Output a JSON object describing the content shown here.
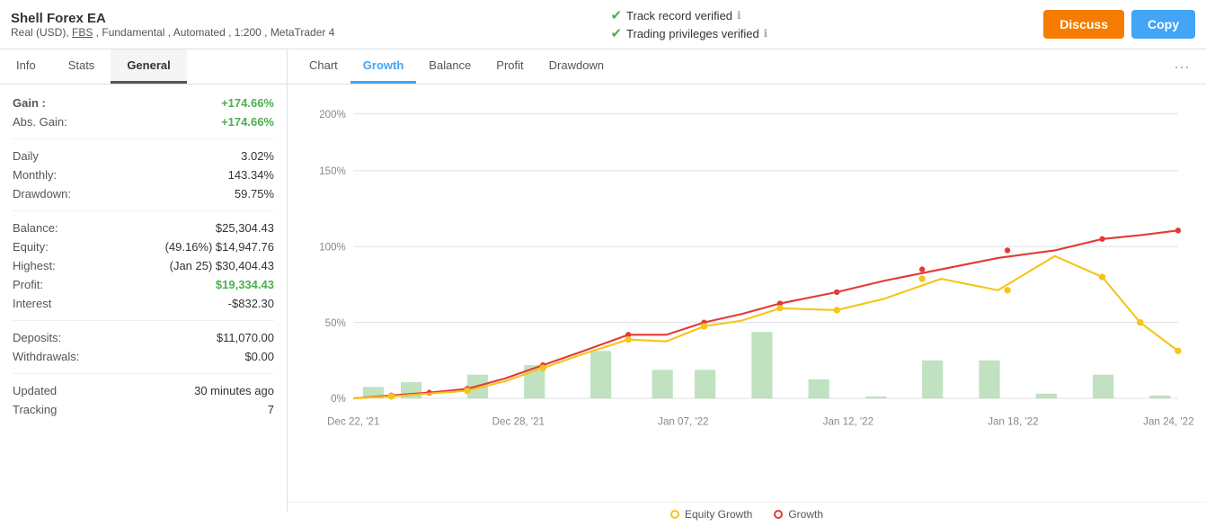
{
  "topbar": {
    "title": "Shell Forex EA",
    "subtitle": "Real (USD),  FBS , Fundamental , Automated , 1:200 , MetaTrader 4",
    "verified1": "Track record verified",
    "verified2": "Trading privileges verified",
    "btn_discuss": "Discuss",
    "btn_copy": "Copy"
  },
  "left_tabs": [
    {
      "label": "Info",
      "active": false
    },
    {
      "label": "Stats",
      "active": false
    },
    {
      "label": "General",
      "active": true
    }
  ],
  "stats": {
    "gain_label": "Gain :",
    "gain_value": "+174.66%",
    "abs_gain_label": "Abs. Gain:",
    "abs_gain_value": "+174.66%",
    "daily_label": "Daily",
    "daily_value": "3.02%",
    "monthly_label": "Monthly:",
    "monthly_value": "143.34%",
    "drawdown_label": "Drawdown:",
    "drawdown_value": "59.75%",
    "balance_label": "Balance:",
    "balance_value": "$25,304.43",
    "equity_label": "Equity:",
    "equity_value": "(49.16%) $14,947.76",
    "highest_label": "Highest:",
    "highest_value": "(Jan 25) $30,404.43",
    "profit_label": "Profit:",
    "profit_value": "$19,334.43",
    "interest_label": "Interest",
    "interest_value": "-$832.30",
    "deposits_label": "Deposits:",
    "deposits_value": "$11,070.00",
    "withdrawals_label": "Withdrawals:",
    "withdrawals_value": "$0.00",
    "updated_label": "Updated",
    "updated_value": "30 minutes ago",
    "tracking_label": "Tracking",
    "tracking_value": "7"
  },
  "chart_tabs": [
    {
      "label": "Chart",
      "active": false
    },
    {
      "label": "Growth",
      "active": true
    },
    {
      "label": "Balance",
      "active": false
    },
    {
      "label": "Profit",
      "active": false
    },
    {
      "label": "Drawdown",
      "active": false
    }
  ],
  "legend": {
    "equity_label": "Equity Growth",
    "growth_label": "Growth",
    "equity_color": "#f5c518",
    "growth_color": "#e53935"
  },
  "x_labels": [
    "Dec 22, '21",
    "Dec 28, '21",
    "Jan 07, '22",
    "Jan 12, '22",
    "Jan 18, '22",
    "Jan 24, '22"
  ],
  "y_labels": [
    "0%",
    "50%",
    "100%",
    "150%",
    "200%"
  ]
}
